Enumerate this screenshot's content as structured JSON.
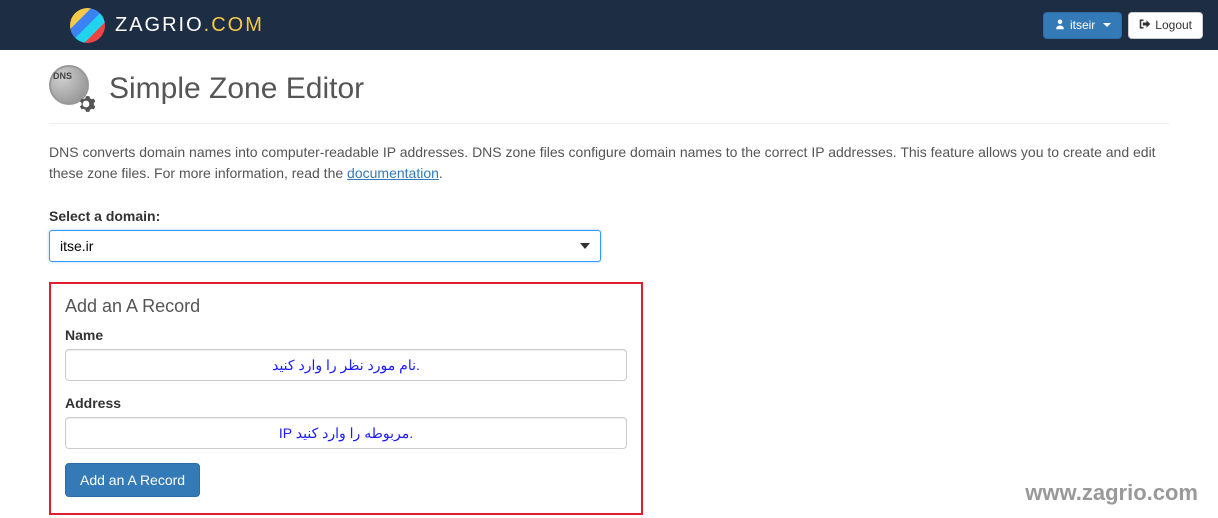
{
  "navbar": {
    "brand": "ZAGRIO",
    "brand_suffix": ".COM",
    "user_label": "itseir",
    "logout_label": "Logout"
  },
  "header": {
    "icon_badge": "DNS",
    "title": "Simple Zone Editor"
  },
  "description": {
    "text_part1": "DNS converts domain names into computer-readable IP addresses. DNS zone files configure domain names to the correct IP addresses. This feature allows you to create and edit these zone files. For more information, read the ",
    "link_text": "documentation",
    "text_part2": "."
  },
  "domain_section": {
    "label": "Select a domain:",
    "selected": "itse.ir"
  },
  "a_record": {
    "section_title": "Add an A Record",
    "name_label": "Name",
    "name_placeholder": "نام مورد نظر را وارد کنید.",
    "address_label": "Address",
    "address_placeholder": "IP مربوطه را وارد کنید.",
    "button_label": "Add an A Record"
  },
  "watermark": "www.zagrio.com"
}
